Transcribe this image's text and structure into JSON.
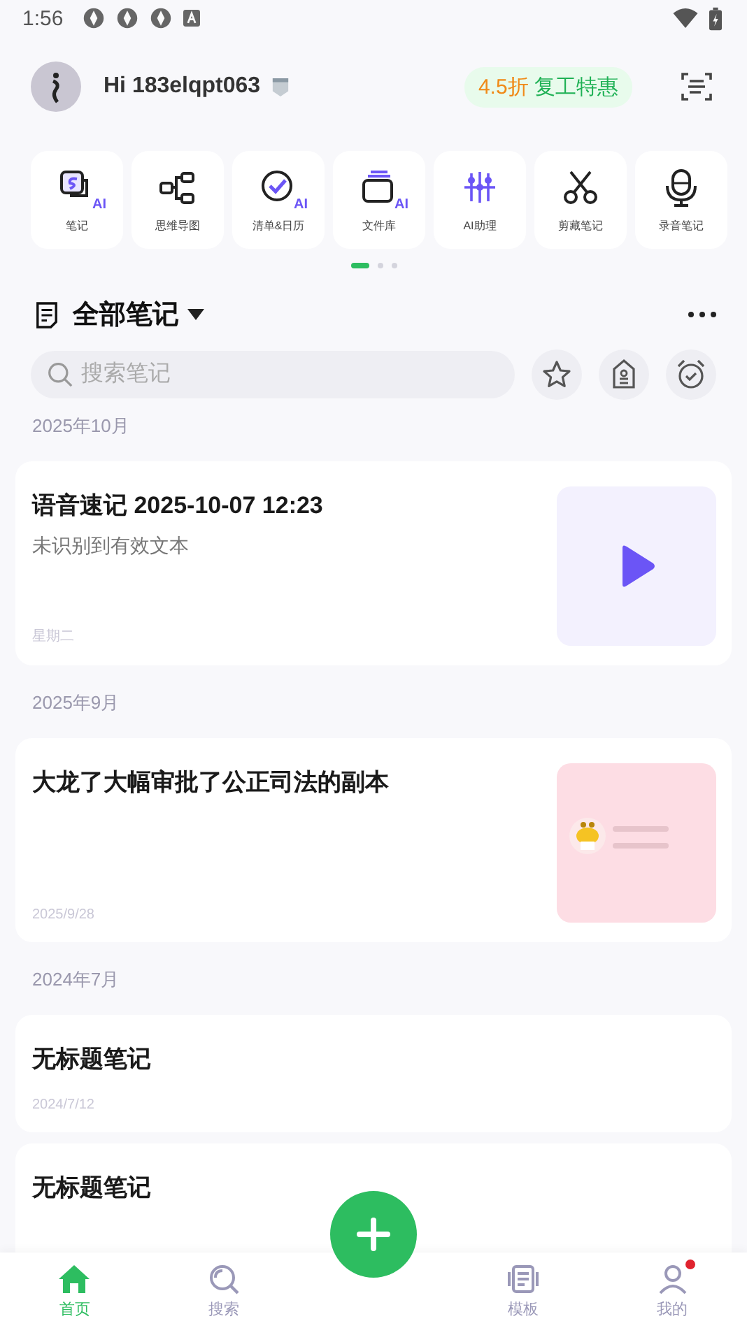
{
  "status_bar": {
    "time": "1:56"
  },
  "header": {
    "greeting": "Hi 183elqpt063",
    "promo": {
      "discount": "4.5折",
      "text": "复工特惠"
    }
  },
  "tools": [
    {
      "kind": "note",
      "label": "笔记",
      "badge": "AI"
    },
    {
      "kind": "mindmap",
      "label": "思维导图"
    },
    {
      "kind": "checklist",
      "label": "清单&日历",
      "badge": "AI"
    },
    {
      "kind": "library",
      "label": "文件库",
      "badge": "AI"
    },
    {
      "kind": "assistant",
      "label": "AI助理"
    },
    {
      "kind": "clip",
      "label": "剪藏笔记"
    },
    {
      "kind": "recorder",
      "label": "录音笔记"
    }
  ],
  "pager": [
    {
      "selected": true
    },
    {
      "selected": false
    },
    {
      "selected": false
    }
  ],
  "notes_header": {
    "title": "全部笔记"
  },
  "search": {
    "placeholder": "搜索笔记"
  },
  "groups": [
    {
      "month": "2025年10月",
      "notes": [
        {
          "title": "语音速记 2025-10-07 12:23",
          "snippet": "未识别到有效文本",
          "date": "星期二",
          "thumbnail": {
            "kind": "audio"
          }
        }
      ]
    },
    {
      "month": "2025年9月",
      "notes": [
        {
          "title": "大龙了大幅审批了公正司法的副本",
          "date": "2025/9/28"
        }
      ]
    },
    {
      "month": "2024年7月",
      "notes": [
        {
          "title": "无标题笔记",
          "date": "2024/7/12"
        },
        {
          "title": "无标题笔记"
        }
      ]
    }
  ],
  "bottom_nav": [
    {
      "kind": "home",
      "label": "首页",
      "selected": true
    },
    {
      "kind": "search",
      "label": "搜索",
      "selected": false
    },
    {
      "kind": "add"
    },
    {
      "kind": "template",
      "label": "模板",
      "selected": false
    },
    {
      "kind": "me",
      "label": "我的",
      "selected": false,
      "badge": true
    }
  ]
}
